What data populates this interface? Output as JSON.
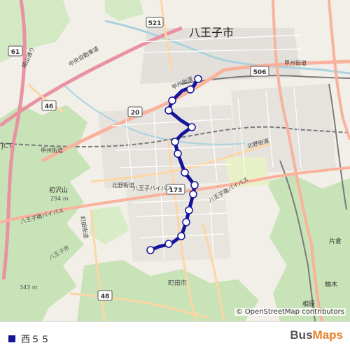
{
  "map": {
    "labels": {
      "city": "八王子市",
      "route_shield_521": "521",
      "route_shield_61": "61",
      "route_shield_46": "46",
      "route_shield_20": "20",
      "route_shield_506": "506",
      "route_shield_173": "173",
      "route_shield_48": "48",
      "koshu_kaido_east": "甲州街道",
      "koshu_kaido_center": "甲州街道",
      "koshu_kaido_west": "甲州街道",
      "kitano_kaido": "北野街道",
      "kitano_kaido_east": "北野街道",
      "chuo_expressway": "中央自動車道",
      "hachioji_bypass": "八王子バイパス",
      "hachioji_minami_bypass": "八王子南バイパス",
      "hachioji_minami_bypass_2": "八王子南バイパス",
      "hatsuzawayama": "初沢山",
      "hatsuzawayama_elev": "294 m",
      "peak_elev": "343 m",
      "machida_kaido": "町田街道",
      "machida_city": "町田市",
      "hachioji_city_sw": "八王子市",
      "jct": "JCT",
      "shiroyama": "城山通り",
      "katakura": "片倉",
      "aihara": "相原",
      "yuginokoro": "柚木",
      "hinodecho": "日の出通り"
    },
    "attribution": {
      "copyright": "©",
      "text": "OpenStreetMap contributors"
    }
  },
  "route": {
    "name": "西５５",
    "color": "#15149a",
    "stop_count": 15
  },
  "brand": {
    "part1": "Bus",
    "part2": "Maps"
  }
}
